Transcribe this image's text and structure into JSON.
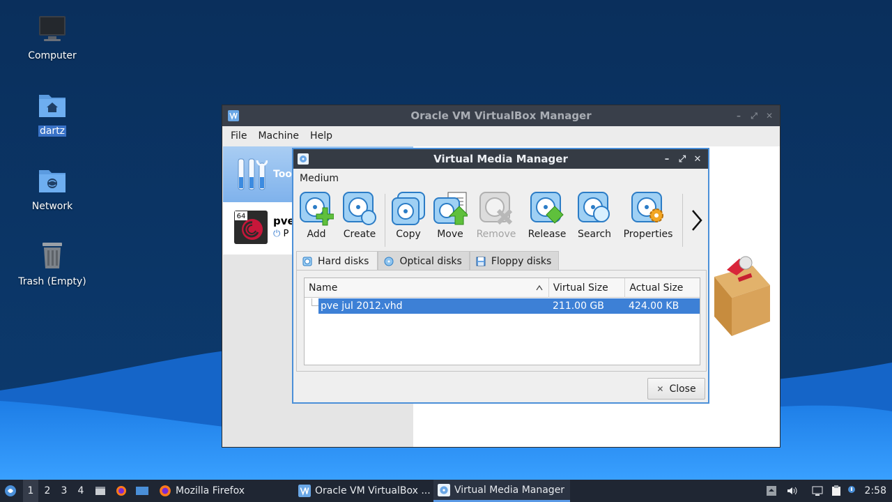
{
  "desktop": {
    "icons": [
      {
        "label": "Computer",
        "icon": "computer-icon"
      },
      {
        "label": "dartz",
        "icon": "home-folder-icon"
      },
      {
        "label": "Network",
        "icon": "network-folder-icon"
      },
      {
        "label": "Trash (Empty)",
        "icon": "trash-icon"
      }
    ]
  },
  "vbox": {
    "title": "Oracle VM VirtualBox Manager",
    "menu": [
      "File",
      "Machine",
      "Help"
    ],
    "tools_label": "Too",
    "vm": {
      "name": "pve",
      "state": "P",
      "badge": "64"
    }
  },
  "vmm": {
    "title": "Virtual Media Manager",
    "menu_label": "Medium",
    "toolbar": [
      {
        "label": "Add",
        "icon": "add-disk-icon",
        "enabled": true
      },
      {
        "label": "Create",
        "icon": "create-disk-icon",
        "enabled": true
      },
      {
        "label": "Copy",
        "icon": "copy-disk-icon",
        "enabled": true
      },
      {
        "label": "Move",
        "icon": "move-disk-icon",
        "enabled": true
      },
      {
        "label": "Remove",
        "icon": "remove-disk-icon",
        "enabled": false
      },
      {
        "label": "Release",
        "icon": "release-disk-icon",
        "enabled": true
      },
      {
        "label": "Search",
        "icon": "search-disk-icon",
        "enabled": true
      },
      {
        "label": "Properties",
        "icon": "properties-disk-icon",
        "enabled": true
      }
    ],
    "tabs": [
      {
        "label": "Hard disks",
        "icon": "hard-disk-icon",
        "active": true
      },
      {
        "label": "Optical disks",
        "icon": "optical-disk-icon",
        "active": false
      },
      {
        "label": "Floppy disks",
        "icon": "floppy-disk-icon",
        "active": false
      }
    ],
    "table": {
      "columns": [
        "Name",
        "Virtual Size",
        "Actual Size"
      ],
      "rows": [
        {
          "name": "pve jul 2012.vhd",
          "virtual_size": "211.00 GB",
          "actual_size": "424.00 KB",
          "selected": true
        }
      ]
    },
    "close_label": "Close"
  },
  "taskbar": {
    "workspaces": [
      "1",
      "2",
      "3",
      "4"
    ],
    "active_workspace": "1",
    "tasks": [
      {
        "label": "Mozilla Firefox",
        "icon": "firefox-icon",
        "active": false
      },
      {
        "label": "Oracle VM VirtualBox ...",
        "icon": "virtualbox-icon",
        "active": false
      },
      {
        "label": "Virtual Media Manager",
        "icon": "virtual-media-icon",
        "active": true
      }
    ],
    "clock": "2:58"
  },
  "colors": {
    "accent": "#3d80d6",
    "titlebar": "#353b44",
    "taskbar": "#1f2633",
    "wallpaper_dark": "#0b2a52",
    "wallpaper_light": "#2e8ff0"
  }
}
